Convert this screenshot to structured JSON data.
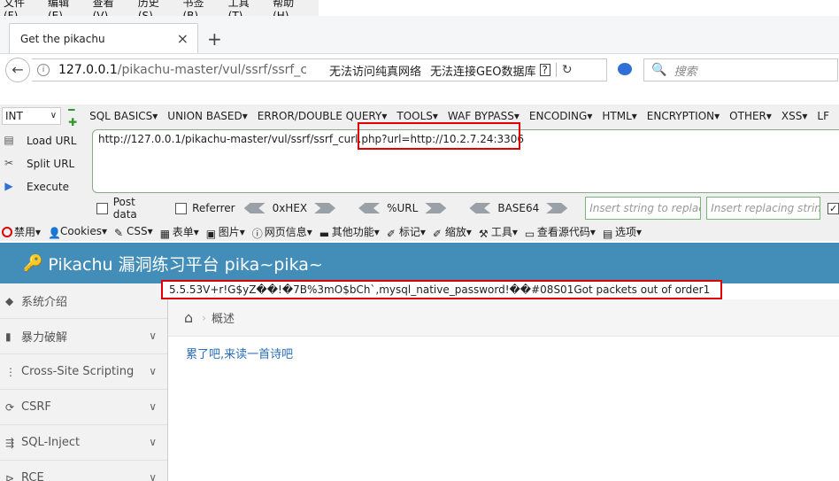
{
  "menubar": [
    "文件(F)",
    "编辑(E)",
    "查看(V)",
    "历史(S)",
    "书签(B)",
    "工具(T)",
    "帮助(H)"
  ],
  "tab": {
    "title": "Get the pikachu",
    "close": "×",
    "new": "+"
  },
  "nav": {
    "url_main": "127.0.0.1",
    "url_path": "/pikachu-master/vul/ssrf/ssrf_curl",
    "notice1": "无法访问纯真网络",
    "notice2": "无法连接GEO数据库",
    "notice_q": "?",
    "search_placeholder": "搜索"
  },
  "hackbar": {
    "select": "INT",
    "menu": [
      "SQL BASICS▾",
      "UNION BASED▾",
      "ERROR/DOUBLE QUERY▾",
      "TOOLS▾",
      "WAF BYPASS▾",
      "ENCODING▾",
      "HTML▾",
      "ENCRYPTION▾",
      "OTHER▾",
      "XSS▾",
      "LF"
    ],
    "load_url": "Load URL",
    "split_url": "Split URL",
    "execute": "Execute",
    "url_value": "http://127.0.0.1/pikachu-master/vul/ssrf/ssrf_curl.php?url=http://10.2.7.24:3306",
    "post_data": "Post data",
    "referrer": "Referrer",
    "hex": "0xHEX",
    "urlenc": "%URL",
    "base64": "BASE64",
    "insert_replace": "Insert string to replace",
    "insert_replacing": "Insert replacing string"
  },
  "devbar": [
    "禁用▾",
    "Cookies▾",
    "CSS▾",
    "表单▾",
    "图片▾",
    "网页信息▾",
    "其他功能▾",
    "标记▾",
    "缩放▾",
    "工具▾",
    "查看源代码▾",
    "选项▾"
  ],
  "page": {
    "brand": "Pikachu 漏洞练习平台 pika~pika~",
    "leak": "5.5.53V+r!G$yZ��!�7B%3mO$bCh`,mysql_native_password!��#08S01Got packets out of order1",
    "crumb": "概述",
    "poem": "累了吧,来读一首诗吧",
    "sidebar": [
      "系统介绍",
      "暴力破解",
      "Cross-Site Scripting",
      "CSRF",
      "SQL-Inject",
      "RCE"
    ]
  }
}
